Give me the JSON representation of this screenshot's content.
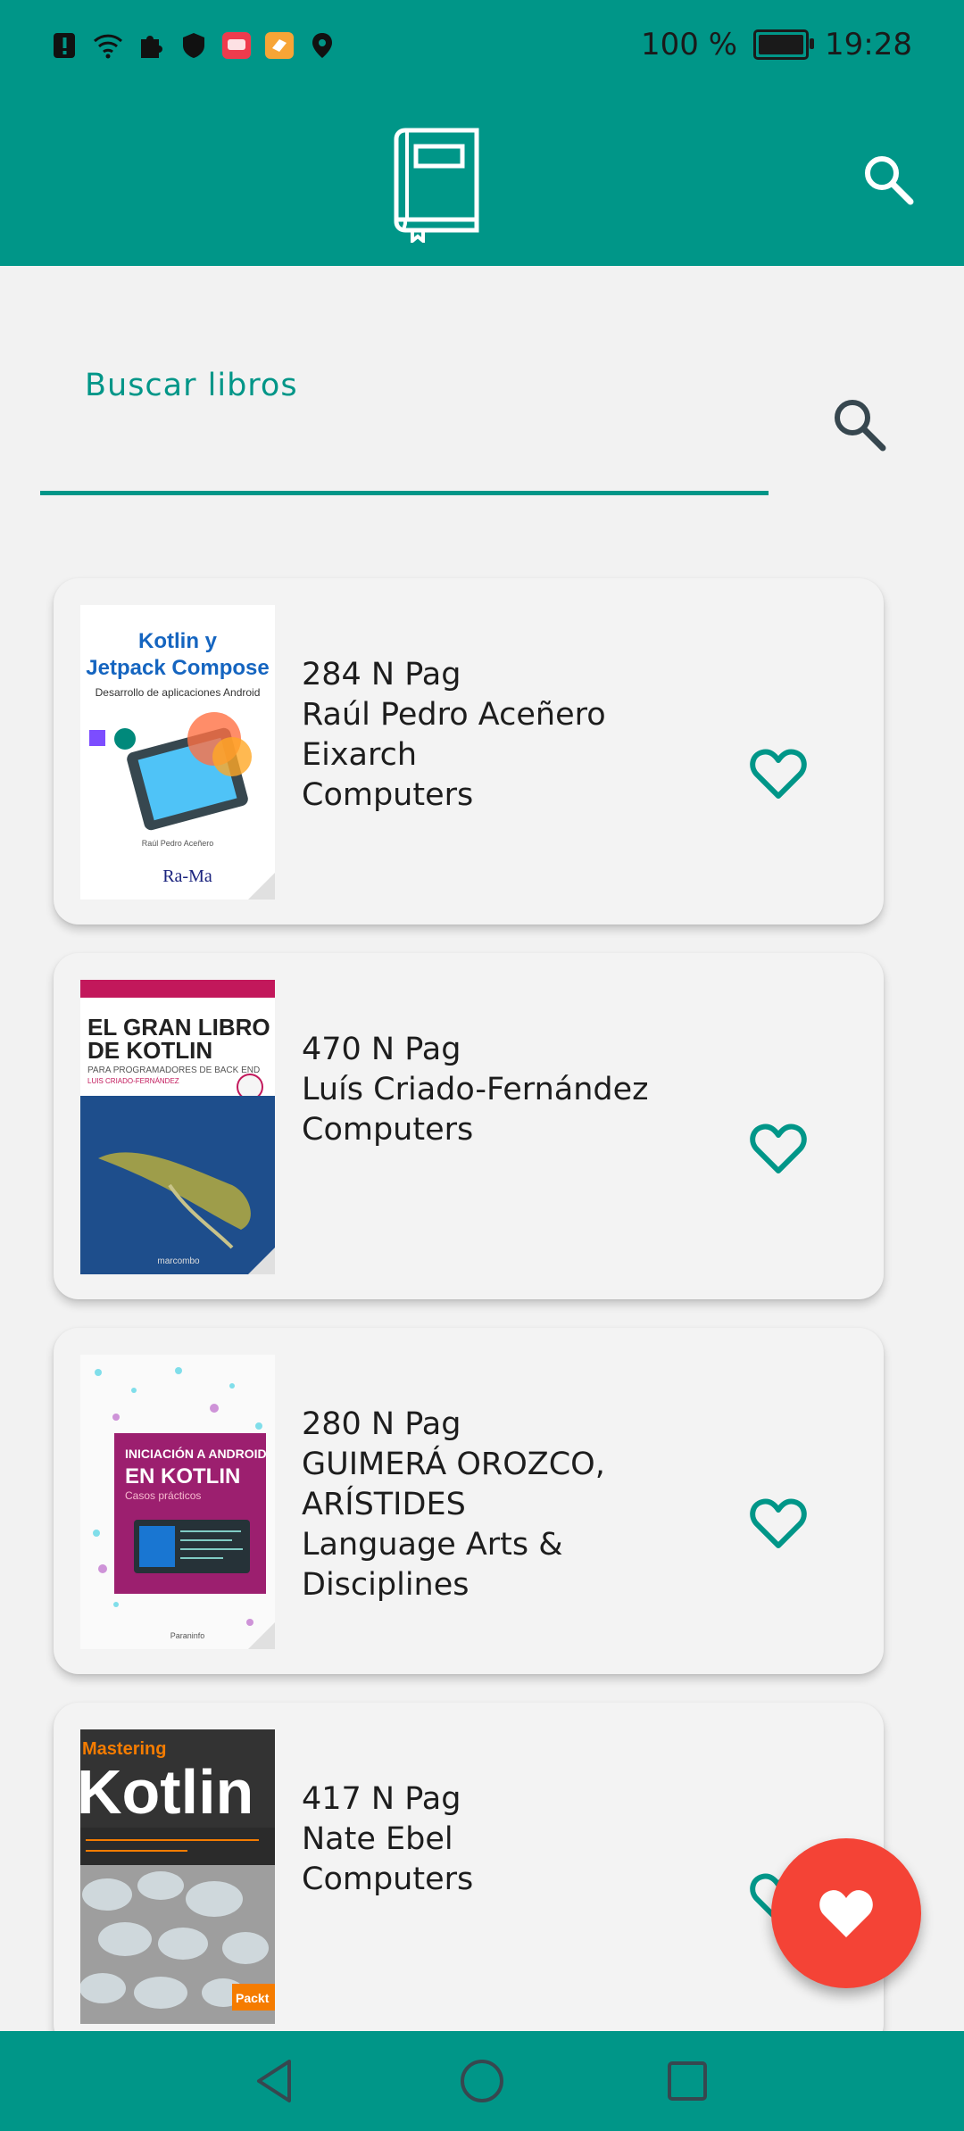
{
  "status_bar": {
    "battery_text": "100 %",
    "time": "19:28",
    "icons": [
      "alert-icon",
      "wifi-icon",
      "puzzle-icon",
      "shield-icon",
      "huawei-icon",
      "pay-icon",
      "location-icon",
      "battery-icon"
    ]
  },
  "app_bar": {
    "logo_icon": "book-icon",
    "search_icon": "search-icon",
    "color": "#009688"
  },
  "search": {
    "label": "Buscar libros"
  },
  "books": [
    {
      "pages": "284 N Pag",
      "author": "Raúl Pedro Aceñero Eixarch",
      "category": "Computers",
      "cover": {
        "title": "Kotlin y Jetpack Compose",
        "subtitle": "Desarrollo de aplicaciones Android",
        "publisher": "Ra-Ma"
      }
    },
    {
      "pages": "470 N Pag",
      "author": "Luís Criado-Fernández",
      "category": "Computers",
      "cover": {
        "title": "EL GRAN LIBRO DE KOTLIN",
        "subtitle": "PARA PROGRAMADORES DE BACK END",
        "publisher": "marcombo"
      }
    },
    {
      "pages": "280 N Pag",
      "author": "GUIMERÁ OROZCO, ARÍSTIDES",
      "category": "Language Arts & Disciplines",
      "cover": {
        "title": "INICIACIÓN A ANDROID EN KOTLIN",
        "subtitle": "Casos prácticos",
        "publisher": "Paraninfo"
      }
    },
    {
      "pages": "417 N Pag",
      "author": "Nate Ebel",
      "category": "Computers",
      "cover": {
        "title": "Kotlin",
        "subtitle": "Mastering",
        "publisher": "Packt"
      }
    }
  ],
  "colors": {
    "accent": "#009688",
    "fab": "#f44336",
    "background": "#f2f2f2"
  }
}
